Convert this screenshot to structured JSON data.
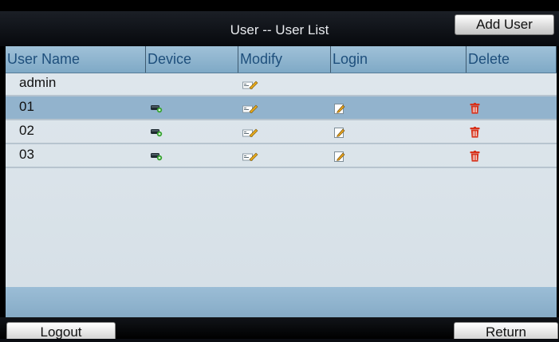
{
  "header": {
    "title": "User -- User List",
    "add_user_label": "Add User"
  },
  "table": {
    "columns": [
      "User Name",
      "Device",
      "Modify",
      "Login",
      "Delete"
    ],
    "rows": [
      {
        "name": "admin",
        "device": false,
        "modify": true,
        "login": false,
        "delete": false,
        "selected": false
      },
      {
        "name": "01",
        "device": true,
        "modify": true,
        "login": true,
        "delete": true,
        "selected": true
      },
      {
        "name": "02",
        "device": true,
        "modify": true,
        "login": true,
        "delete": true,
        "selected": false
      },
      {
        "name": "03",
        "device": true,
        "modify": true,
        "login": true,
        "delete": true,
        "selected": false
      }
    ]
  },
  "footer": {
    "logout_label": "Logout",
    "return_label": "Return"
  },
  "icons": {
    "device": "device-icon",
    "modify": "modify-icon",
    "login": "edit-pencil-icon",
    "delete": "trash-icon"
  },
  "colors": {
    "header_text": "#1e4f7c",
    "selected_row": "#92b3cd",
    "delete_red": "#d7331c"
  }
}
